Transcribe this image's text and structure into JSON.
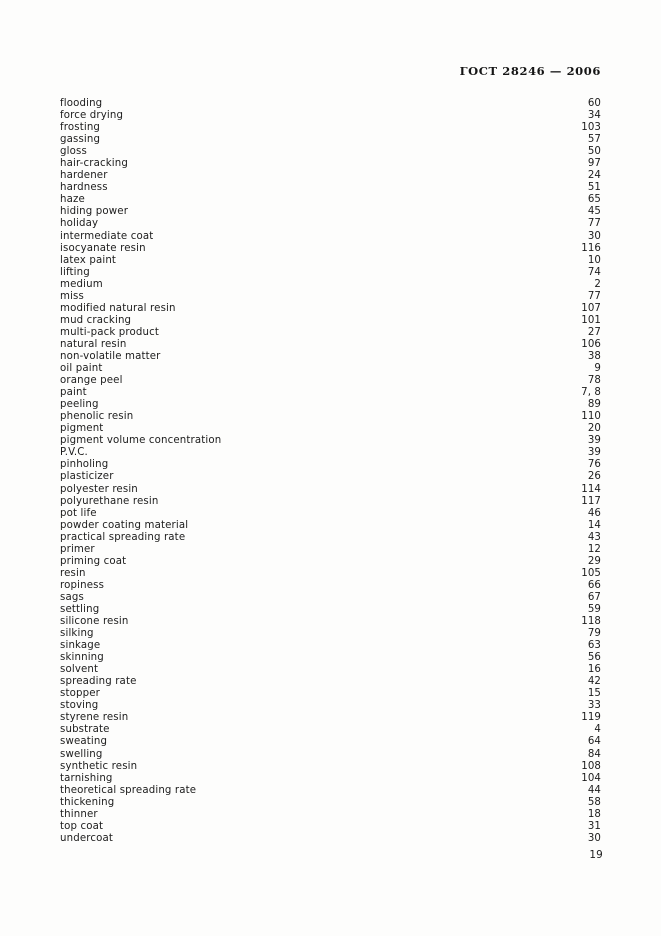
{
  "header": {
    "standard_ref": "ГОСТ 28246 — 2006"
  },
  "footer": {
    "page_number": "19"
  },
  "index": {
    "entries": [
      {
        "term": "flooding",
        "page": "60"
      },
      {
        "term": "force drying",
        "page": "34"
      },
      {
        "term": "frosting",
        "page": "103"
      },
      {
        "term": "gassing",
        "page": "57"
      },
      {
        "term": "gloss",
        "page": "50"
      },
      {
        "term": "hair-cracking",
        "page": "97"
      },
      {
        "term": "hardener",
        "page": "24"
      },
      {
        "term": "hardness",
        "page": "51"
      },
      {
        "term": "haze",
        "page": "65"
      },
      {
        "term": "hiding power",
        "page": "45"
      },
      {
        "term": "holiday",
        "page": "77"
      },
      {
        "term": "intermediate coat",
        "page": "30"
      },
      {
        "term": "isocyanate resin",
        "page": "116"
      },
      {
        "term": "latex paint",
        "page": "10"
      },
      {
        "term": "lifting",
        "page": "74"
      },
      {
        "term": "medium",
        "page": "2"
      },
      {
        "term": "miss",
        "page": "77"
      },
      {
        "term": "modified natural resin",
        "page": "107"
      },
      {
        "term": "mud cracking",
        "page": "101"
      },
      {
        "term": "multi-pack product",
        "page": "27"
      },
      {
        "term": "natural resin",
        "page": "106"
      },
      {
        "term": "non-volatile matter",
        "page": "38"
      },
      {
        "term": "oil paint",
        "page": "9"
      },
      {
        "term": "orange peel",
        "page": "78"
      },
      {
        "term": "paint",
        "page": "7, 8"
      },
      {
        "term": "peeling",
        "page": "89"
      },
      {
        "term": "phenolic resin",
        "page": "110"
      },
      {
        "term": "pigment",
        "page": "20"
      },
      {
        "term": "pigment volume concentration",
        "page": "39"
      },
      {
        "term": "P.V.C.",
        "page": "39"
      },
      {
        "term": "pinholing",
        "page": "76"
      },
      {
        "term": "plasticizer",
        "page": "26"
      },
      {
        "term": "polyester resin",
        "page": "114"
      },
      {
        "term": "polyurethane resin",
        "page": "117"
      },
      {
        "term": "pot life",
        "page": "46"
      },
      {
        "term": "powder coating material",
        "page": "14"
      },
      {
        "term": "practical spreading rate",
        "page": "43"
      },
      {
        "term": "primer",
        "page": "12"
      },
      {
        "term": "priming coat",
        "page": "29"
      },
      {
        "term": "resin",
        "page": "105"
      },
      {
        "term": "ropiness",
        "page": "66"
      },
      {
        "term": "sags",
        "page": "67"
      },
      {
        "term": "settling",
        "page": "59"
      },
      {
        "term": "silicone resin",
        "page": "118"
      },
      {
        "term": "silking",
        "page": "79"
      },
      {
        "term": "sinkage",
        "page": "63"
      },
      {
        "term": "skinning",
        "page": "56"
      },
      {
        "term": "solvent",
        "page": "16"
      },
      {
        "term": "spreading rate",
        "page": "42"
      },
      {
        "term": "stopper",
        "page": "15"
      },
      {
        "term": "stoving",
        "page": "33"
      },
      {
        "term": "styrene resin",
        "page": "119"
      },
      {
        "term": "substrate",
        "page": "4"
      },
      {
        "term": "sweating",
        "page": "64"
      },
      {
        "term": "swelling",
        "page": "84"
      },
      {
        "term": "synthetic resin",
        "page": "108"
      },
      {
        "term": "tarnishing",
        "page": "104"
      },
      {
        "term": "theoretical spreading rate",
        "page": "44"
      },
      {
        "term": "thickening",
        "page": "58"
      },
      {
        "term": "thinner",
        "page": "18"
      },
      {
        "term": "top coat",
        "page": "31"
      },
      {
        "term": "undercoat",
        "page": "30"
      }
    ]
  }
}
